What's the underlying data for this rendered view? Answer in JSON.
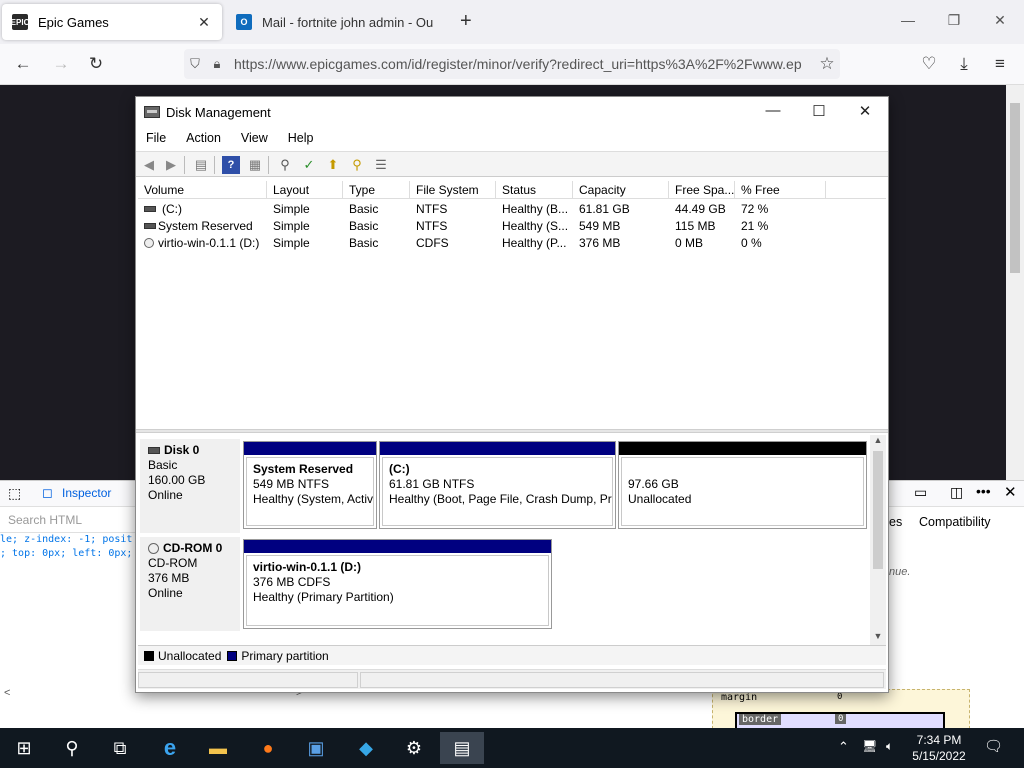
{
  "browser": {
    "tabs": [
      {
        "title": "Epic Games",
        "favicon": "EPIC"
      },
      {
        "title": "Mail - fortnite john admin - Ou",
        "favicon": "O"
      }
    ],
    "url": "https://www.epicgames.com/id/register/minor/verify?redirect_uri=https%3A%2F%2Fwww.ep"
  },
  "devtools": {
    "inspector_tab": "Inspector",
    "search_placeholder": "Search HTML",
    "code_line1": "le; z-index: -1; posit",
    "code_line2": "; top: 0px; left: 0px;",
    "compat_tab": "Compatibility",
    "rules_tab_partial": "es",
    "italic_text": "nue.",
    "box_margin_label": "margin",
    "box_margin_value": "0",
    "box_border_label": "border",
    "box_border_value": "0"
  },
  "disk_management": {
    "title": "Disk Management",
    "menu": [
      "File",
      "Action",
      "View",
      "Help"
    ],
    "columns": [
      "Volume",
      "Layout",
      "Type",
      "File System",
      "Status",
      "Capacity",
      "Free Spa...",
      "% Free"
    ],
    "volumes": [
      {
        "volume": "(C:)",
        "layout": "Simple",
        "type": "Basic",
        "fs": "NTFS",
        "status": "Healthy (B...",
        "capacity": "61.81 GB",
        "free": "44.49 GB",
        "pct": "72 %"
      },
      {
        "volume": "System Reserved",
        "layout": "Simple",
        "type": "Basic",
        "fs": "NTFS",
        "status": "Healthy (S...",
        "capacity": "549 MB",
        "free": "115 MB",
        "pct": "21 %"
      },
      {
        "volume": "virtio-win-0.1.1 (D:)",
        "layout": "Simple",
        "type": "Basic",
        "fs": "CDFS",
        "status": "Healthy (P...",
        "capacity": "376 MB",
        "free": "0 MB",
        "pct": "0 %"
      }
    ],
    "disks": [
      {
        "name": "Disk 0",
        "type": "Basic",
        "size": "160.00 GB",
        "state": "Online",
        "partitions": [
          {
            "name": "System Reserved",
            "detail": "549 MB NTFS",
            "status": "Healthy (System, Activ"
          },
          {
            "name": "(C:)",
            "detail": "61.81 GB NTFS",
            "status": "Healthy (Boot, Page File, Crash Dump, Prir"
          },
          {
            "name": "",
            "detail": "97.66 GB",
            "status": "Unallocated"
          }
        ]
      },
      {
        "name": "CD-ROM 0",
        "type": "CD-ROM",
        "size": "376 MB",
        "state": "Online",
        "partitions": [
          {
            "name": "virtio-win-0.1.1  (D:)",
            "detail": "376 MB CDFS",
            "status": "Healthy (Primary Partition)"
          }
        ]
      }
    ],
    "legend": [
      {
        "label": "Unallocated",
        "color": "#000000"
      },
      {
        "label": "Primary partition",
        "color": "#000080"
      }
    ]
  },
  "colors": {
    "primary_partition": "#000080",
    "unallocated": "#000000"
  },
  "taskbar": {
    "time": "7:34 PM",
    "date": "5/15/2022"
  }
}
